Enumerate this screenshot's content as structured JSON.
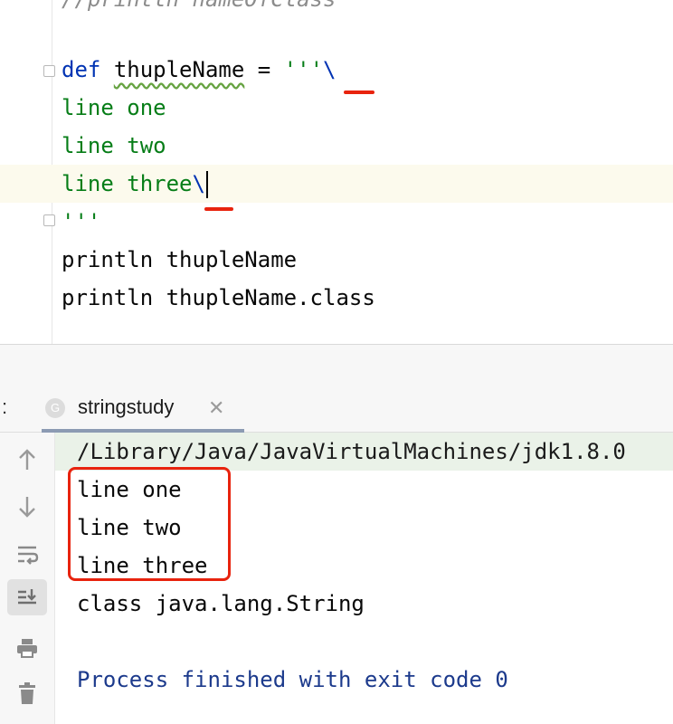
{
  "editor": {
    "partial_line": "//println nameOfClass",
    "def_keyword": "def",
    "var_name": "thupleName",
    "assign": " = ",
    "str_open": "'''",
    "backslash": "\\",
    "line1": "line one",
    "line2": "line two",
    "line3": "line three",
    "str_close": "'''",
    "print1_cmd": "println",
    "print1_arg": "thupleName",
    "print2_cmd": "println",
    "print2_arg": "thupleName.class"
  },
  "tool_window": {
    "prefix": ":",
    "tab_icon_letter": "G",
    "tab_label": "stringstudy",
    "tab_close": "✕"
  },
  "console": {
    "path": "/Library/Java/JavaVirtualMachines/jdk1.8.0",
    "out1": "line one",
    "out2": "line two",
    "out3": "line three",
    "out4": "class java.lang.String",
    "exit_message": "Process finished with exit code 0"
  },
  "icons": {
    "up": "arrow-up-icon",
    "down": "arrow-down-icon",
    "wrap": "soft-wrap-icon",
    "scroll": "scroll-to-end-icon",
    "print": "print-icon",
    "trash": "trash-icon"
  },
  "colors": {
    "keyword": "#0033b3",
    "string": "#067d17",
    "annotation_red": "#e8230e",
    "exit_text": "#1c3a8c"
  }
}
